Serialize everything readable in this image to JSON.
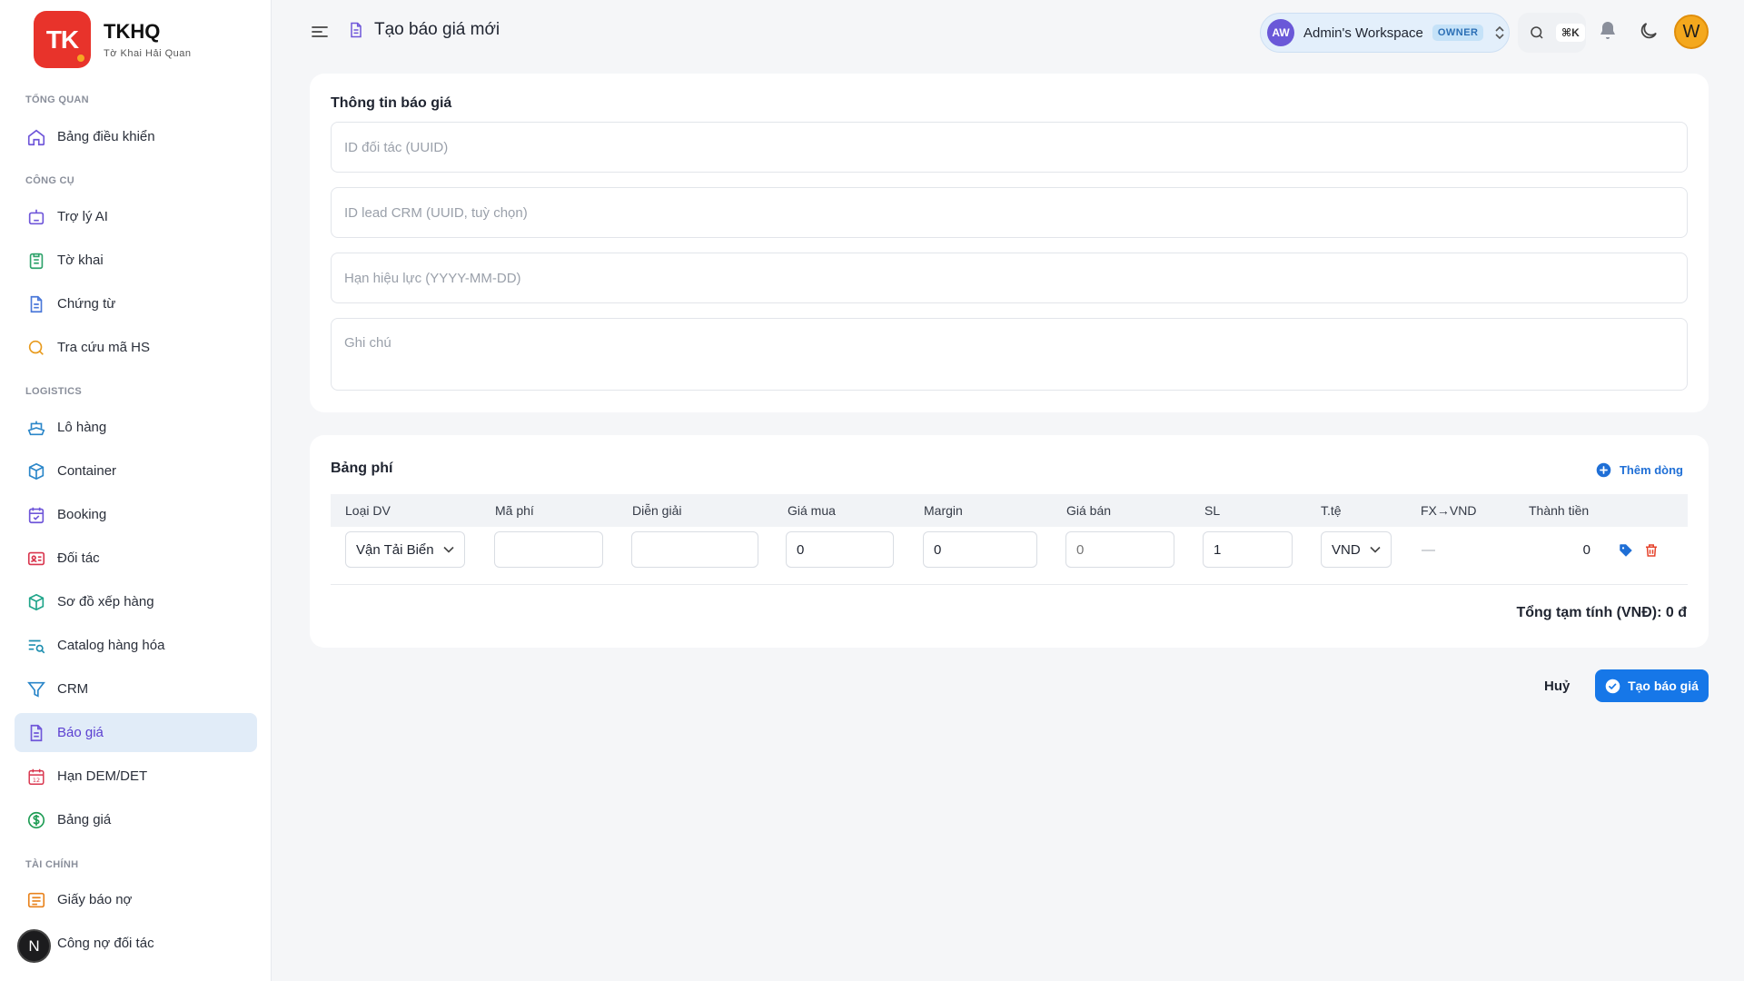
{
  "brand": {
    "logo_text": "TK",
    "title": "TKHQ",
    "subtitle": "Tờ Khai Hải Quan"
  },
  "sidebar": {
    "sections": [
      {
        "label": "TỔNG QUAN"
      },
      {
        "label": "CÔNG CỤ"
      },
      {
        "label": "LOGISTICS"
      },
      {
        "label": "TÀI CHÍNH"
      }
    ],
    "items": [
      {
        "label": "Bảng điều khiển",
        "icon": "home-icon"
      },
      {
        "label": "Trợ lý AI",
        "icon": "robot-icon"
      },
      {
        "label": "Tờ khai",
        "icon": "clipboard-icon"
      },
      {
        "label": "Chứng từ",
        "icon": "document-icon"
      },
      {
        "label": "Tra cứu mã HS",
        "icon": "search-icon"
      },
      {
        "label": "Lô hàng",
        "icon": "ship-icon"
      },
      {
        "label": "Container",
        "icon": "box-icon"
      },
      {
        "label": "Booking",
        "icon": "calendar-check-icon"
      },
      {
        "label": "Đối tác",
        "icon": "id-card-icon"
      },
      {
        "label": "Sơ đồ xếp hàng",
        "icon": "cube-icon"
      },
      {
        "label": "Catalog hàng hóa",
        "icon": "catalog-search-icon"
      },
      {
        "label": "CRM",
        "icon": "funnel-icon"
      },
      {
        "label": "Báo giá",
        "icon": "quote-document-icon"
      },
      {
        "label": "Hạn DEM/DET",
        "icon": "calendar-12-icon"
      },
      {
        "label": "Bảng giá",
        "icon": "dollar-circle-icon"
      },
      {
        "label": "Giấy báo nợ",
        "icon": "message-lines-icon"
      },
      {
        "label": "Công nợ đối tác",
        "icon": "ledger-icon"
      }
    ],
    "active_item": "Báo giá",
    "bottom_badge": "N"
  },
  "header": {
    "title": "Tạo báo giá mới",
    "workspace": {
      "initials": "AW",
      "name": "Admin's Workspace",
      "role": "OWNER"
    },
    "search_shortcut": "⌘K",
    "user_initial": "W"
  },
  "quote_info": {
    "title": "Thông tin báo giá",
    "partner_id_placeholder": "ID đối tác (UUID)",
    "crm_lead_placeholder": "ID lead CRM (UUID, tuỳ chọn)",
    "validity_placeholder": "Hạn hiệu lực (YYYY-MM-DD)",
    "notes_placeholder": "Ghi chú"
  },
  "fee_table": {
    "title": "Bảng phí",
    "add_row_label": "Thêm dòng",
    "columns": [
      "Loại DV",
      "Mã phí",
      "Diễn giải",
      "Giá mua",
      "Margin",
      "Giá bán",
      "SL",
      "T.tệ",
      "FX→VND",
      "Thành tiền"
    ],
    "rows": [
      {
        "service_type": "Vận Tải Biển",
        "fee_code": "",
        "description": "",
        "buy_price": "0",
        "margin": "0",
        "sell_price_placeholder": "0",
        "quantity": "1",
        "currency": "VND",
        "fx_to_vnd": "—",
        "amount": "0"
      }
    ],
    "subtotal_label": "Tổng tạm tính (VNĐ): 0 đ"
  },
  "actions": {
    "cancel_label": "Huỷ",
    "submit_label": "Tạo báo giá"
  },
  "colors": {
    "accent": "#1677e8",
    "brand_red": "#e8332b",
    "active_nav_bg": "#e1ecf8",
    "active_nav_text": "#5b3fd1"
  }
}
